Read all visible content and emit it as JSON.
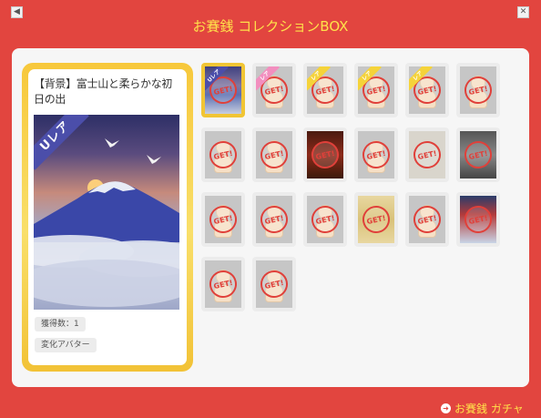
{
  "window": {
    "title": "お賽銭 コレクションBOX",
    "nav_left_icon": "arrow-left-icon",
    "nav_right_icon": "close-icon"
  },
  "detail": {
    "title": "【背景】富士山と柔らかな初日の出",
    "rarity": "Uレア",
    "count_label": "獲得数：1",
    "kind_label": "変化アバター"
  },
  "items": [
    {
      "ribbon": "Uレア",
      "ribbon_color": "ur",
      "image": "mountain",
      "stamp": "GET!",
      "selected": true
    },
    {
      "ribbon": "レア",
      "ribbon_color": "pink",
      "image": "doll",
      "stamp": "GET!"
    },
    {
      "ribbon": "レア",
      "ribbon_color": "yellow",
      "image": "doll",
      "stamp": "GET!"
    },
    {
      "ribbon": "レア",
      "ribbon_color": "yellow",
      "image": "doll",
      "stamp": "GET!"
    },
    {
      "ribbon": "レア",
      "ribbon_color": "yellow",
      "image": "doll",
      "stamp": "GET!"
    },
    {
      "ribbon": "",
      "ribbon_color": "",
      "image": "doll",
      "stamp": "GET!"
    },
    {
      "ribbon": "",
      "ribbon_color": "",
      "image": "doll",
      "stamp": "GET!"
    },
    {
      "ribbon": "",
      "ribbon_color": "",
      "image": "doll",
      "stamp": "GET!"
    },
    {
      "ribbon": "",
      "ribbon_color": "",
      "image": "stage",
      "stamp": "GET!"
    },
    {
      "ribbon": "",
      "ribbon_color": "",
      "image": "doll",
      "stamp": "GET!"
    },
    {
      "ribbon": "",
      "ribbon_color": "",
      "image": "paper",
      "stamp": "GET!"
    },
    {
      "ribbon": "",
      "ribbon_color": "",
      "image": "dark",
      "stamp": "GET!"
    },
    {
      "ribbon": "",
      "ribbon_color": "",
      "image": "doll",
      "stamp": "GET!"
    },
    {
      "ribbon": "",
      "ribbon_color": "",
      "image": "doll",
      "stamp": "GET!"
    },
    {
      "ribbon": "",
      "ribbon_color": "",
      "image": "doll",
      "stamp": "GET!"
    },
    {
      "ribbon": "",
      "ribbon_color": "",
      "image": "gold",
      "stamp": "GET!"
    },
    {
      "ribbon": "",
      "ribbon_color": "",
      "image": "doll",
      "stamp": "GET!"
    },
    {
      "ribbon": "",
      "ribbon_color": "",
      "image": "shrine",
      "stamp": "GET!"
    },
    {
      "ribbon": "",
      "ribbon_color": "",
      "image": "doll",
      "stamp": "GET!"
    },
    {
      "ribbon": "",
      "ribbon_color": "",
      "image": "doll",
      "stamp": "GET!"
    }
  ],
  "footer": {
    "link_label": "お賽銭 ガチャ",
    "link_icon": "arrow-right-circle-icon"
  },
  "colors": {
    "background": "#e2453f",
    "title": "#ffe14a",
    "card_gold": "#f7c83b",
    "stamp": "#e0403a"
  }
}
